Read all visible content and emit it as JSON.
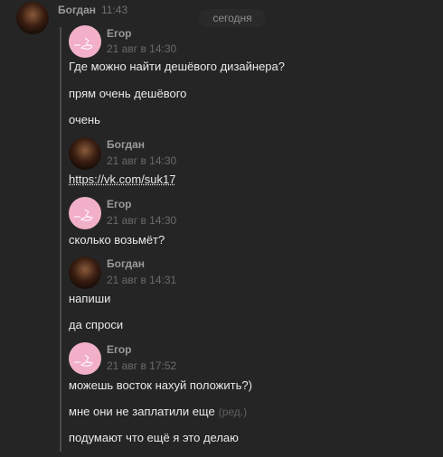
{
  "header": {
    "sender": "Богдан",
    "time": "11:43",
    "date_separator": "сегодня"
  },
  "quoted_messages": [
    {
      "sender": "Егор",
      "time": "21 авг в 14:30",
      "lines": [
        "Где можно найти дешёвого дизайнера?",
        "прям очень дешёвого",
        "очень"
      ]
    },
    {
      "sender": "Богдан",
      "time": "21 авг в 14:30",
      "lines": [
        "https://vk.com/suk17"
      ]
    },
    {
      "sender": "Егор",
      "time": "21 авг в 14:30",
      "lines": [
        "сколько возьмёт?"
      ]
    },
    {
      "sender": "Богдан",
      "time": "21 авг в 14:31",
      "lines": [
        "напиши",
        "да спроси"
      ]
    },
    {
      "sender": "Егор",
      "time": "21 авг в 17:52",
      "lines": [
        "можешь восток нахуй положить?)",
        "мне они не заплатили еще",
        "подумают что ещё я это делаю"
      ],
      "edited_label": "(ред.)"
    }
  ],
  "colors": {
    "background": "#252525",
    "avatar_egor": "#f2b0c8",
    "quote_line": "#4b4b4b"
  }
}
